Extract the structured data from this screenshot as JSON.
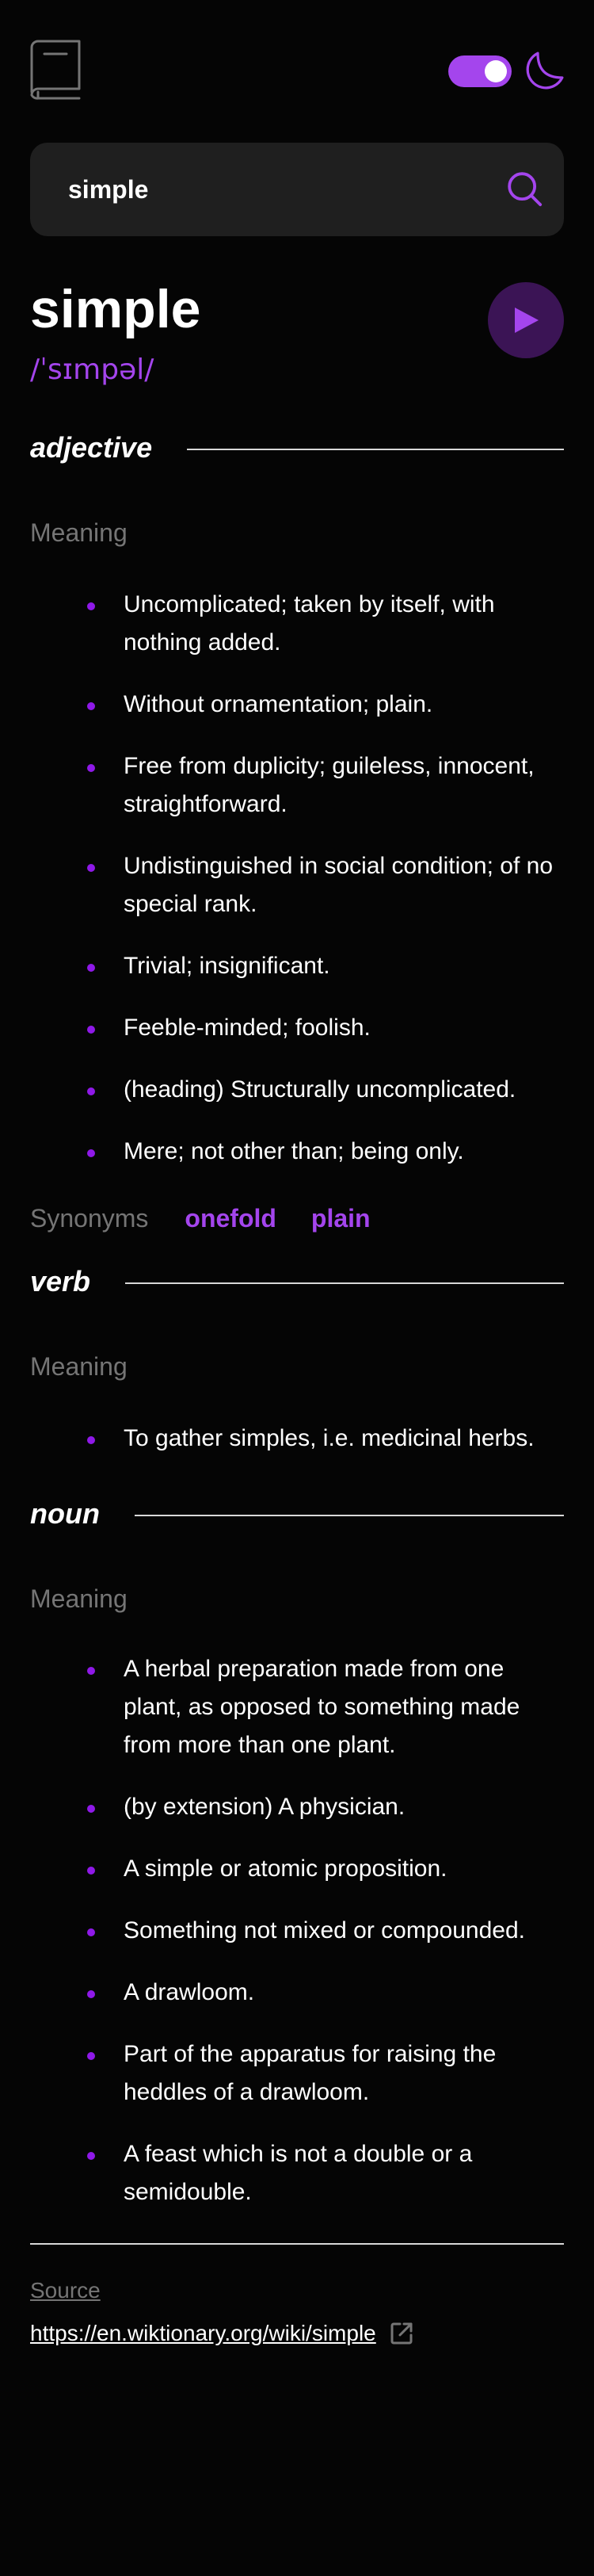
{
  "header": {
    "logo_icon": "book-icon",
    "theme_toggle_on": true,
    "theme_icon": "moon-icon",
    "accent": "#a445ed"
  },
  "search": {
    "value": "simple",
    "icon": "search-icon"
  },
  "entry": {
    "word": "simple",
    "phonetic": "/ˈsɪmpəl/",
    "play_icon": "play-icon"
  },
  "meanings": [
    {
      "part_of_speech": "adjective",
      "heading": "Meaning",
      "definitions": [
        "Uncomplicated; taken by itself, with nothing added.",
        "Without ornamentation; plain.",
        "Free from duplicity; guileless, innocent, straightforward.",
        "Undistinguished in social condition; of no special rank.",
        "Trivial; insignificant.",
        "Feeble-minded; foolish.",
        "(heading) Structurally uncomplicated.",
        "Mere; not other than; being only."
      ],
      "synonyms_label": "Synonyms",
      "synonyms": [
        "onefold",
        "plain"
      ]
    },
    {
      "part_of_speech": "verb",
      "heading": "Meaning",
      "definitions": [
        "To gather simples, i.e. medicinal herbs."
      ]
    },
    {
      "part_of_speech": "noun",
      "heading": "Meaning",
      "definitions": [
        "A herbal preparation made from one plant, as opposed to something made from more than one plant.",
        "(by extension) A physician.",
        "A simple or atomic proposition.",
        "Something not mixed or compounded.",
        "A drawloom.",
        "Part of the apparatus for raising the heddles of a drawloom.",
        "A feast which is not a double or a semidouble."
      ]
    }
  ],
  "source": {
    "label": "Source",
    "url": "https://en.wiktionary.org/wiki/simple",
    "icon": "external-link-icon"
  }
}
